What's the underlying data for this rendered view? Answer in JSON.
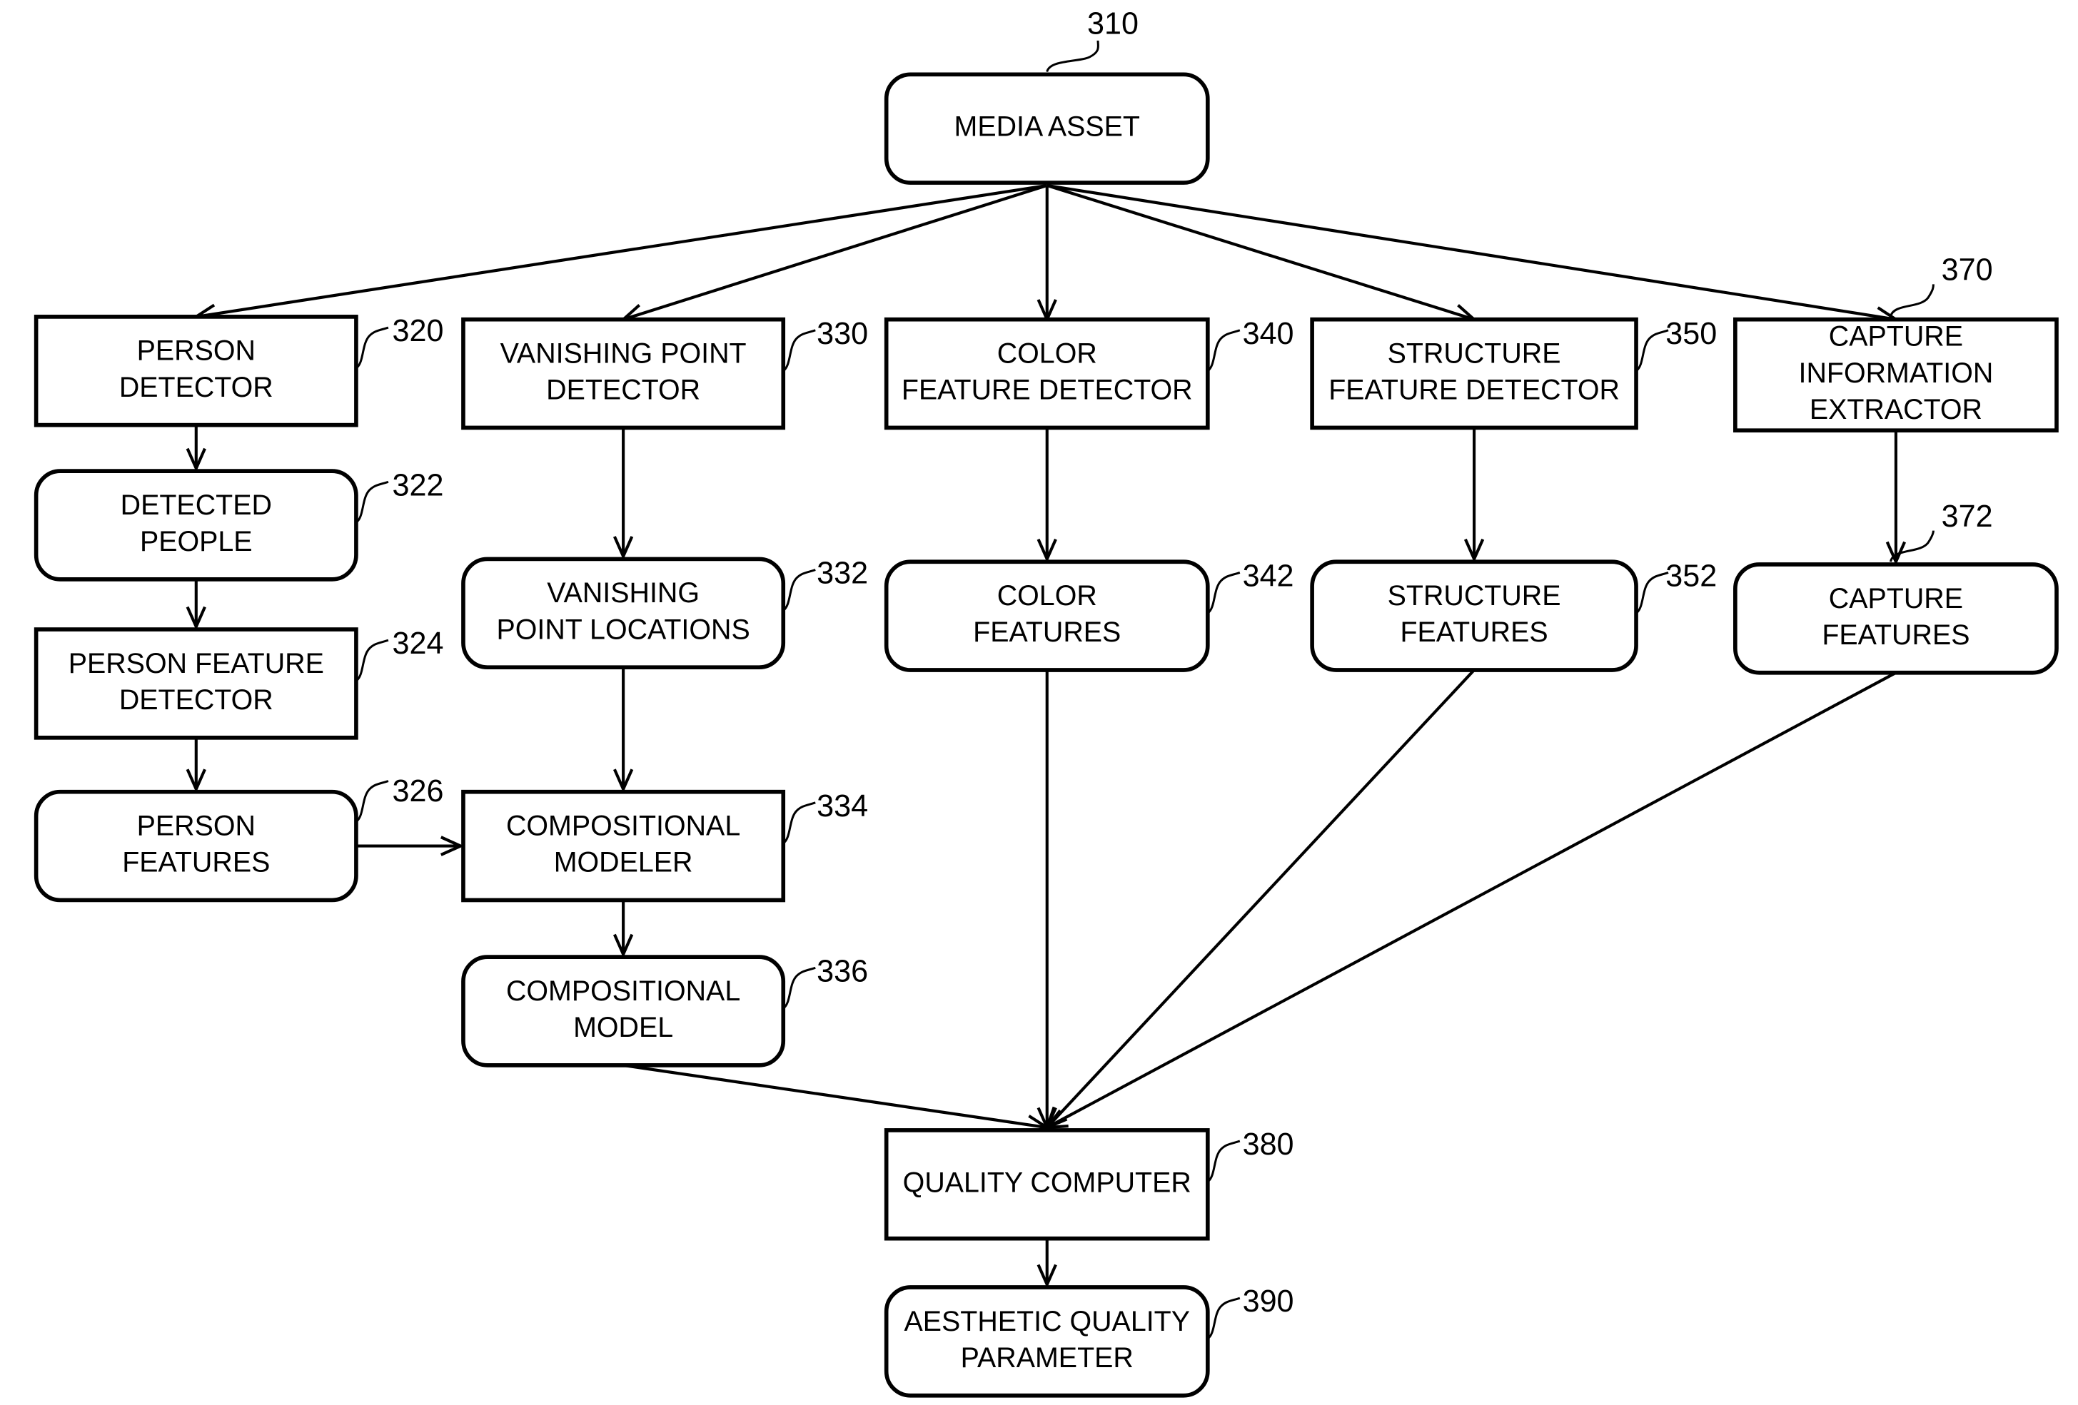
{
  "figure": {
    "nodes": [
      {
        "id": "310",
        "ref": "310",
        "shape": "rounded",
        "lines": [
          "MEDIA ASSET"
        ]
      },
      {
        "id": "320",
        "ref": "320",
        "shape": "rect",
        "lines": [
          "PERSON",
          "DETECTOR"
        ]
      },
      {
        "id": "322",
        "ref": "322",
        "shape": "rounded",
        "lines": [
          "DETECTED",
          "PEOPLE"
        ]
      },
      {
        "id": "324",
        "ref": "324",
        "shape": "rect",
        "lines": [
          "PERSON  FEATURE",
          "DETECTOR"
        ]
      },
      {
        "id": "326",
        "ref": "326",
        "shape": "rounded",
        "lines": [
          "PERSON",
          "FEATURES"
        ]
      },
      {
        "id": "330",
        "ref": "330",
        "shape": "rect",
        "lines": [
          "VANISHING POINT",
          "DETECTOR"
        ]
      },
      {
        "id": "332",
        "ref": "332",
        "shape": "rounded",
        "lines": [
          "VANISHING",
          "POINT LOCATIONS"
        ]
      },
      {
        "id": "334",
        "ref": "334",
        "shape": "rect",
        "lines": [
          "COMPOSITIONAL",
          "MODELER"
        ]
      },
      {
        "id": "336",
        "ref": "336",
        "shape": "rounded",
        "lines": [
          "COMPOSITIONAL",
          "MODEL"
        ]
      },
      {
        "id": "340",
        "ref": "340",
        "shape": "rect",
        "lines": [
          "COLOR",
          "FEATURE DETECTOR"
        ]
      },
      {
        "id": "342",
        "ref": "342",
        "shape": "rounded",
        "lines": [
          "COLOR",
          "FEATURES"
        ]
      },
      {
        "id": "350",
        "ref": "350",
        "shape": "rect",
        "lines": [
          "STRUCTURE",
          "FEATURE DETECTOR"
        ]
      },
      {
        "id": "352",
        "ref": "352",
        "shape": "rounded",
        "lines": [
          "STRUCTURE",
          "FEATURES"
        ]
      },
      {
        "id": "370",
        "ref": "370",
        "shape": "rect",
        "lines": [
          "CAPTURE",
          "INFORMATION",
          "EXTRACTOR"
        ]
      },
      {
        "id": "372",
        "ref": "372",
        "shape": "rounded",
        "lines": [
          "CAPTURE",
          "FEATURES"
        ]
      },
      {
        "id": "380",
        "ref": "380",
        "shape": "rect",
        "lines": [
          "QUALITY COMPUTER"
        ]
      },
      {
        "id": "390",
        "ref": "390",
        "shape": "rounded",
        "lines": [
          "AESTHETIC QUALITY",
          "PARAMETER"
        ]
      }
    ],
    "edges": [
      {
        "from": "310",
        "to": "320"
      },
      {
        "from": "310",
        "to": "330"
      },
      {
        "from": "310",
        "to": "340"
      },
      {
        "from": "310",
        "to": "350"
      },
      {
        "from": "310",
        "to": "370"
      },
      {
        "from": "320",
        "to": "322"
      },
      {
        "from": "322",
        "to": "324"
      },
      {
        "from": "324",
        "to": "326"
      },
      {
        "from": "326",
        "to": "334"
      },
      {
        "from": "330",
        "to": "332"
      },
      {
        "from": "332",
        "to": "334"
      },
      {
        "from": "334",
        "to": "336"
      },
      {
        "from": "340",
        "to": "342"
      },
      {
        "from": "350",
        "to": "352"
      },
      {
        "from": "370",
        "to": "372"
      },
      {
        "from": "336",
        "to": "380"
      },
      {
        "from": "342",
        "to": "380"
      },
      {
        "from": "352",
        "to": "380"
      },
      {
        "from": "372",
        "to": "380"
      },
      {
        "from": "380",
        "to": "390"
      }
    ]
  }
}
